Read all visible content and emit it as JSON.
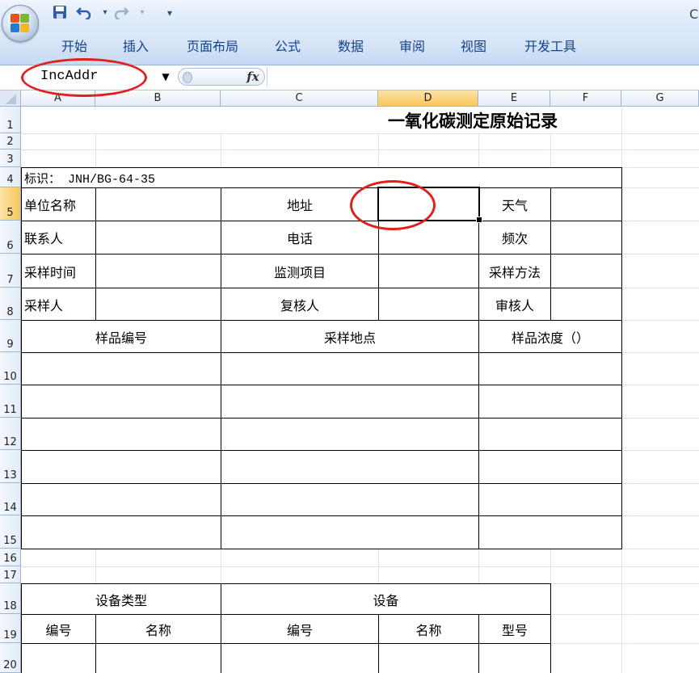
{
  "quick_access": {
    "save_icon": "save-icon",
    "undo_icon": "undo-icon",
    "redo_icon": "redo-icon",
    "customize_icon": "customize-icon"
  },
  "title_fragment": "C",
  "ribbon_tabs": [
    "开始",
    "插入",
    "页面布局",
    "公式",
    "数据",
    "审阅",
    "视图",
    "开发工具"
  ],
  "name_box": {
    "value": "IncAddr"
  },
  "formula_bar": {
    "fx_label": "fx",
    "value": ""
  },
  "columns": [
    "A",
    "B",
    "C",
    "D",
    "E",
    "F",
    "G"
  ],
  "selected_column": "D",
  "rows": [
    "1",
    "2",
    "3",
    "4",
    "5",
    "6",
    "7",
    "8",
    "9",
    "10",
    "11",
    "12",
    "13",
    "14",
    "15",
    "16",
    "17",
    "18",
    "19",
    "20"
  ],
  "selected_row": "5",
  "sheet": {
    "title": "一氧化碳测定原始记录",
    "mark": "标识： JNH/BG-64-35",
    "unit_name": "单位名称",
    "address": "地址",
    "weather": "天气",
    "contact": "联系人",
    "phone": "电话",
    "frequency": "频次",
    "sampling_time": "采样时间",
    "monitor_item": "监测项目",
    "sampling_method": "采样方法",
    "sampler": "采样人",
    "rechecker": "复核人",
    "reviewer": "审核人",
    "sample_no": "样品编号",
    "sampling_site": "采样地点",
    "sample_conc": "样品浓度（）",
    "equip_type": "设备类型",
    "equipment": "设备",
    "number": "编号",
    "name": "名称",
    "equip_number": "编号",
    "equip_name": "名称",
    "model": "型号"
  },
  "accent_colors": {
    "annotation_red": "#e0201c",
    "ribbon_text": "#15428b",
    "selection_header": "#f9c85a"
  }
}
